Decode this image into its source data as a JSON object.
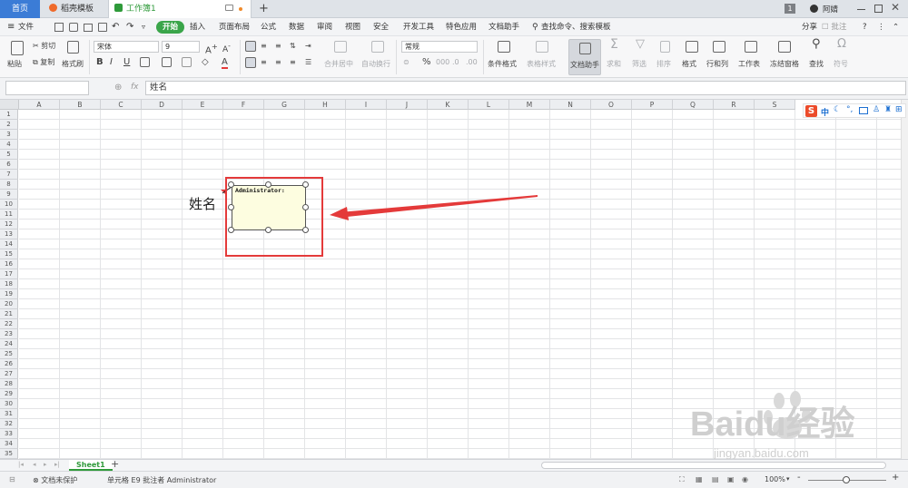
{
  "tabs": {
    "home": "首页",
    "shell": "稻壳模板",
    "workbook": "工作簿1",
    "new_tab": "+"
  },
  "window": {
    "badge": "1",
    "user": "阿婧"
  },
  "menu": {
    "file": "文件",
    "start": "开始",
    "items": [
      "插入",
      "页面布局",
      "公式",
      "数据",
      "审阅",
      "视图",
      "安全",
      "开发工具",
      "特色应用",
      "文档助手"
    ],
    "search": "查找命令、搜索模板",
    "share": "分享",
    "comment": "批注",
    "help": "?"
  },
  "ribbon": {
    "paste": "粘贴",
    "cut": "剪切",
    "copy": "复制",
    "format_painter": "格式刷",
    "font_name": "宋体",
    "font_size": "9",
    "bold": "B",
    "italic": "I",
    "underline": "U",
    "merge_center": "合并居中",
    "wrap": "自动换行",
    "number_format": "常规",
    "percent": "%",
    "conditional_format": "条件格式",
    "table_style": "表格样式",
    "doc_helper": "文档助手",
    "sum": "求和",
    "filter": "筛选",
    "sort": "排序",
    "format": "格式",
    "row_col": "行和列",
    "worksheet": "工作表",
    "freeze": "冻结窗格",
    "find": "查找",
    "symbol": "符号"
  },
  "formula_bar": {
    "fx": "fx",
    "content": "姓名"
  },
  "columns": [
    "A",
    "B",
    "C",
    "D",
    "E",
    "F",
    "G",
    "H",
    "I",
    "J",
    "K",
    "L",
    "M",
    "N",
    "O",
    "P",
    "Q",
    "R",
    "S"
  ],
  "rows": [
    "1",
    "2",
    "3",
    "4",
    "5",
    "6",
    "7",
    "8",
    "9",
    "10",
    "11",
    "12",
    "13",
    "14",
    "15",
    "16",
    "17",
    "18",
    "19",
    "20",
    "21",
    "22",
    "23",
    "24",
    "25",
    "26",
    "27",
    "28",
    "29",
    "30",
    "31",
    "32",
    "33",
    "34",
    "35"
  ],
  "cell_e9": "姓名",
  "comment": {
    "author": "Administrator:"
  },
  "ime": {
    "mode": "中"
  },
  "sheets": {
    "active": "Sheet1",
    "add": "+"
  },
  "status": {
    "protect": "文档未保护",
    "info": "单元格 E9 批注者 Administrator",
    "zoom": "100%",
    "minus": "-",
    "plus": "+"
  },
  "watermark": {
    "brand": "Baidu经验",
    "url": "jingyan.baidu.com"
  },
  "colors": {
    "accent_green": "#3aa54a",
    "home_blue": "#3b7cd6",
    "annotation_red": "#e43a3a",
    "comment_bg": "#fdfde0"
  }
}
